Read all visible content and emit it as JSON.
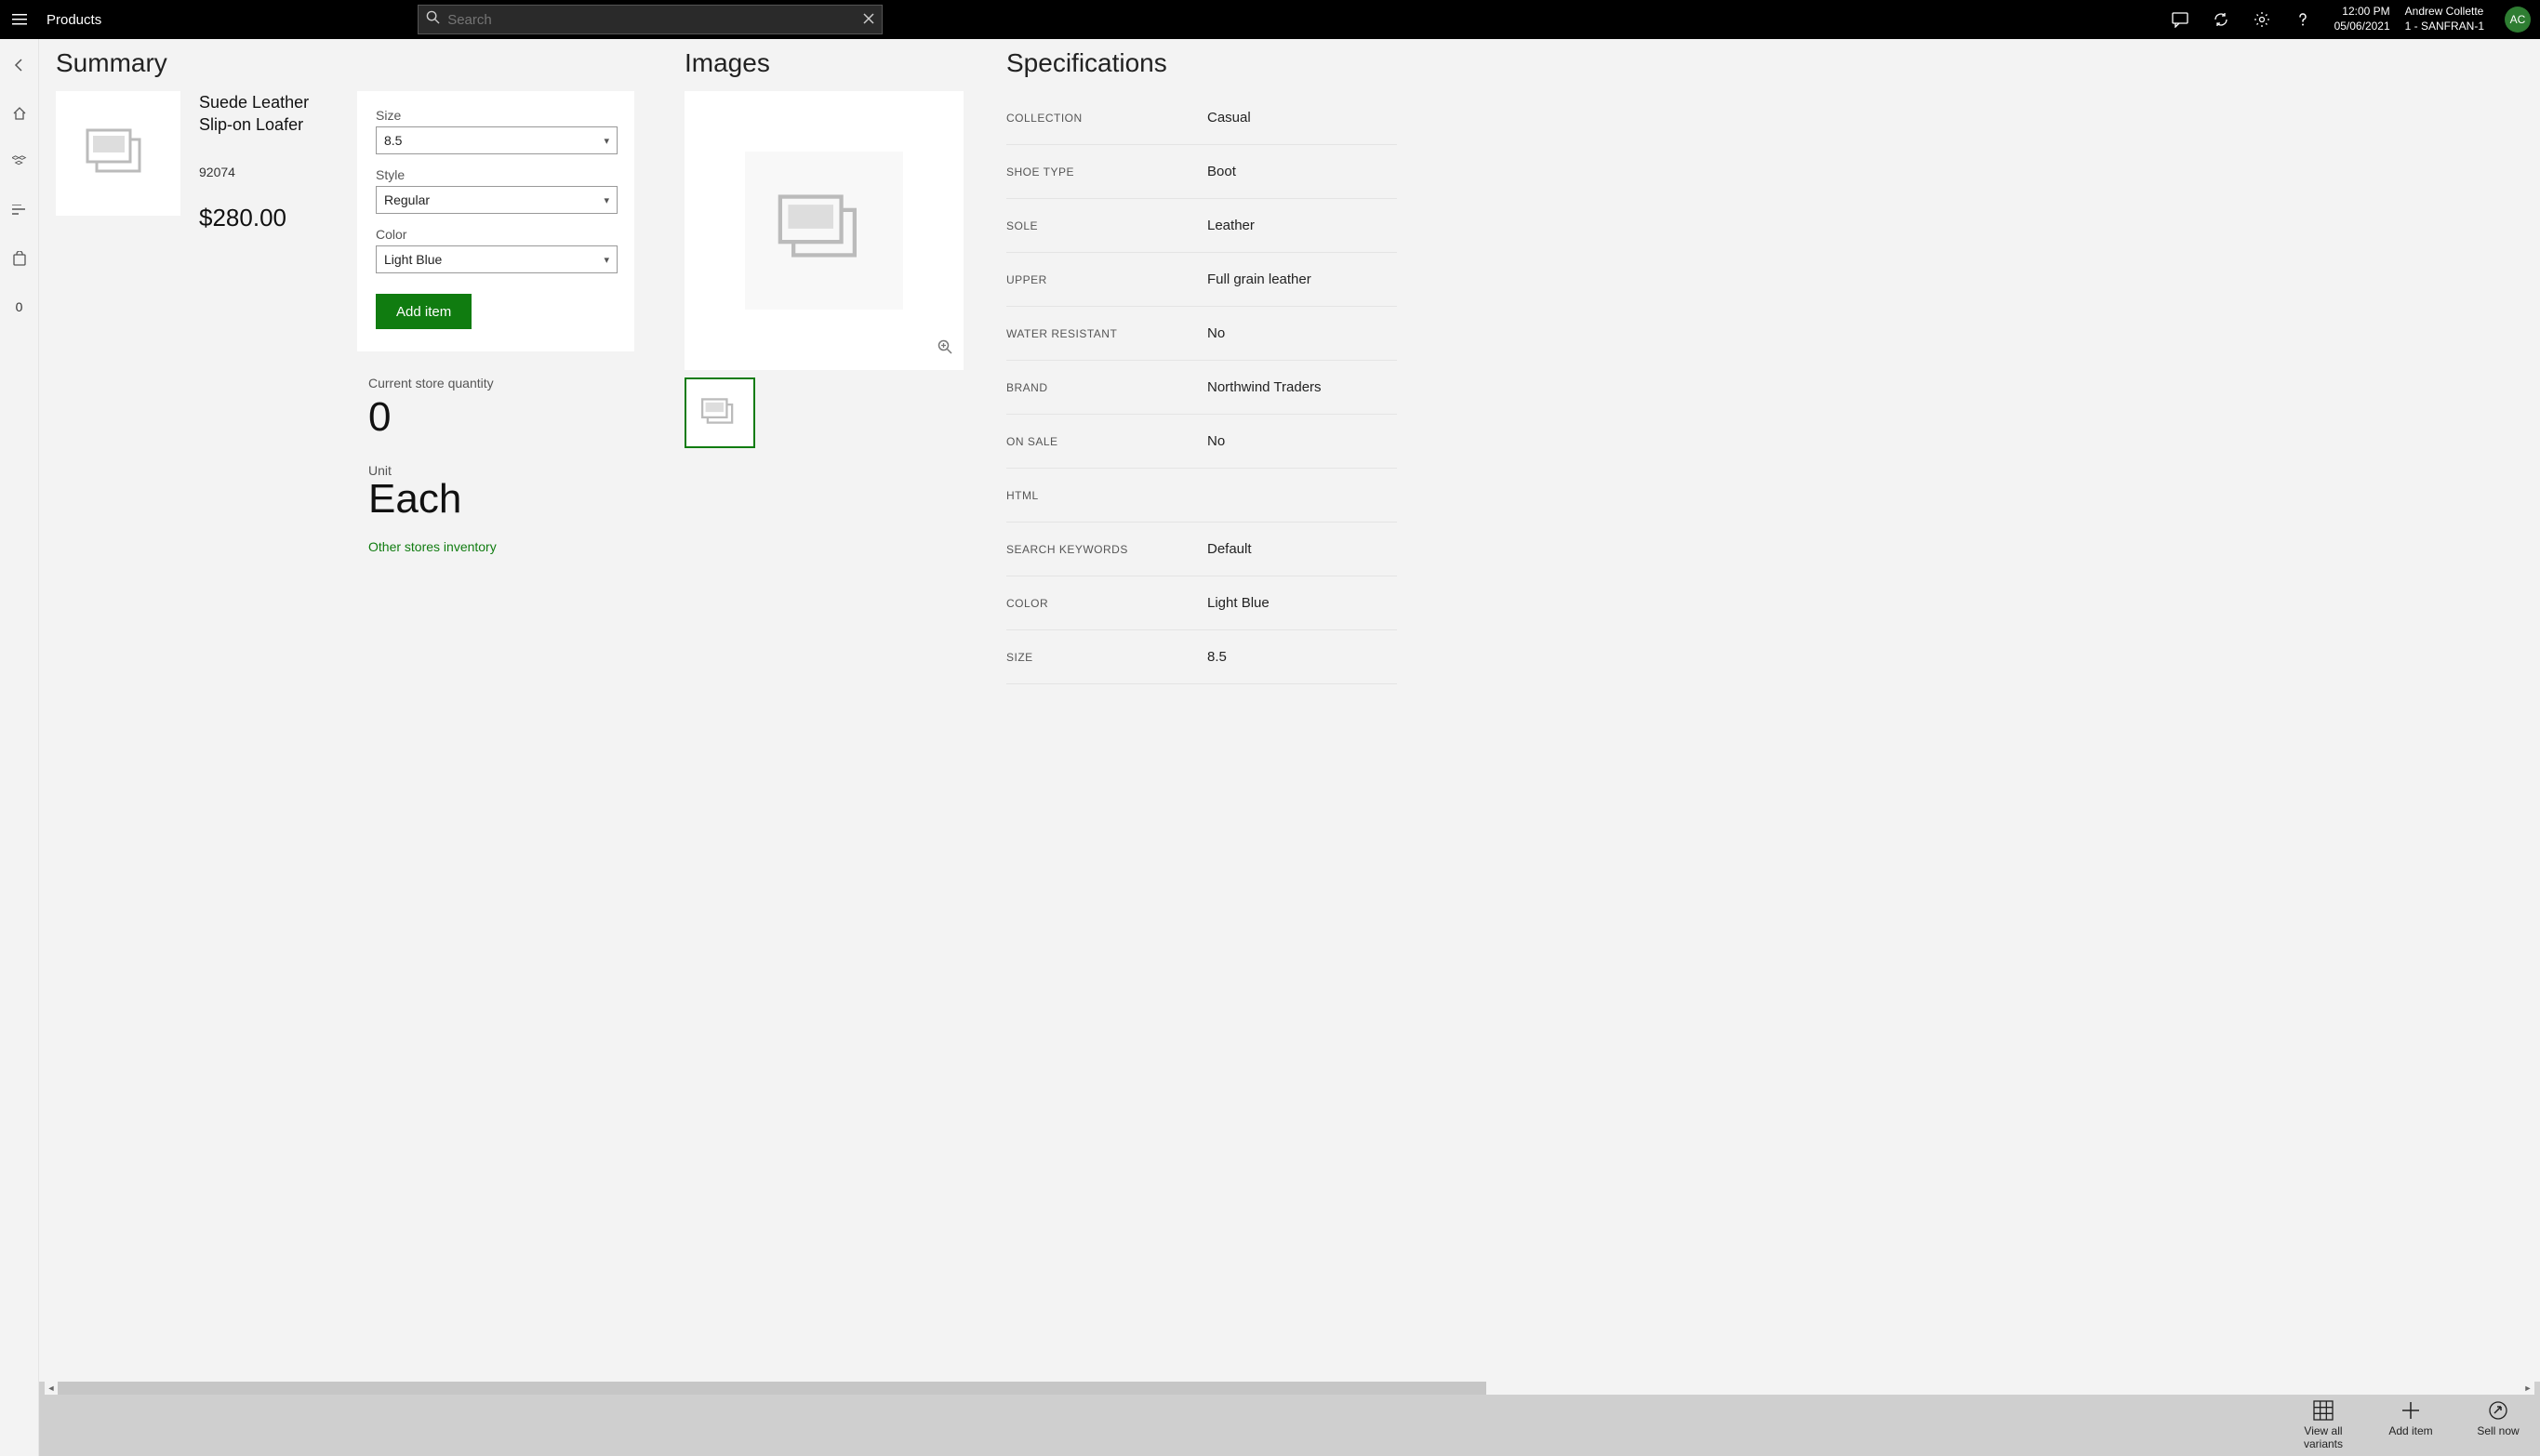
{
  "header": {
    "app_title": "Products",
    "search_placeholder": "Search",
    "time": "12:00 PM",
    "date": "05/06/2021",
    "user_name": "Andrew Collette",
    "store": "1 - SANFRAN-1",
    "avatar_initials": "AC"
  },
  "sidebar": {
    "badge": "0"
  },
  "summary": {
    "heading": "Summary",
    "product_title": "Suede Leather Slip-on Loafer",
    "product_id": "92074",
    "price": "$280.00",
    "variant": {
      "size_label": "Size",
      "size_value": "8.5",
      "style_label": "Style",
      "style_value": "Regular",
      "color_label": "Color",
      "color_value": "Light Blue",
      "add_button": "Add item"
    },
    "qty_label": "Current store quantity",
    "qty_value": "0",
    "unit_label": "Unit",
    "unit_value": "Each",
    "other_link": "Other stores inventory"
  },
  "images": {
    "heading": "Images"
  },
  "specs": {
    "heading": "Specifications",
    "rows": [
      {
        "key": "COLLECTION",
        "value": "Casual"
      },
      {
        "key": "SHOE TYPE",
        "value": "Boot"
      },
      {
        "key": "SOLE",
        "value": "Leather"
      },
      {
        "key": "UPPER",
        "value": "Full grain leather"
      },
      {
        "key": "WATER RESISTANT",
        "value": "No"
      },
      {
        "key": "BRAND",
        "value": "Northwind Traders"
      },
      {
        "key": "ON SALE",
        "value": "No"
      },
      {
        "key": "HTML",
        "value": ""
      },
      {
        "key": "SEARCH KEYWORDS",
        "value": "Default"
      },
      {
        "key": "COLOR",
        "value": "Light Blue"
      },
      {
        "key": "SIZE",
        "value": "8.5"
      }
    ]
  },
  "bottom": {
    "view_all_variants": "View all variants",
    "add_item": "Add item",
    "sell_now": "Sell now"
  }
}
